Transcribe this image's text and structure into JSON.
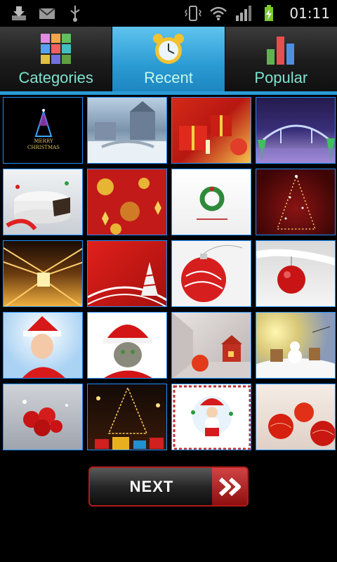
{
  "status": {
    "time": "01:11"
  },
  "tabs": [
    {
      "label": "Categories",
      "icon": "grid-icon",
      "active": false
    },
    {
      "label": "Recent",
      "icon": "alarm-clock-icon",
      "active": true
    },
    {
      "label": "Popular",
      "icon": "bar-chart-icon",
      "active": false
    }
  ],
  "thumbnails": [
    "merry-christmas-tree",
    "snowy-castle",
    "red-gifts",
    "lit-bridge",
    "christmas-cake",
    "red-ornaments",
    "green-wreath",
    "sparkle-tree",
    "lights-tunnel",
    "red-ribbon-tree",
    "red-bauble",
    "snow-bauble",
    "santa-girl",
    "santa-kitten",
    "red-room",
    "moon-snowman",
    "red-roses",
    "street-lights",
    "santa-card",
    "red-baubles"
  ],
  "thumb_text": {
    "merry": "MERRY",
    "christmas": "CHRISTMAS"
  },
  "next": {
    "label": "NEXT"
  },
  "colors": {
    "accent": "#2a9ad6",
    "tab_text": "#7fe3cf",
    "next_border": "#b31a1a"
  }
}
